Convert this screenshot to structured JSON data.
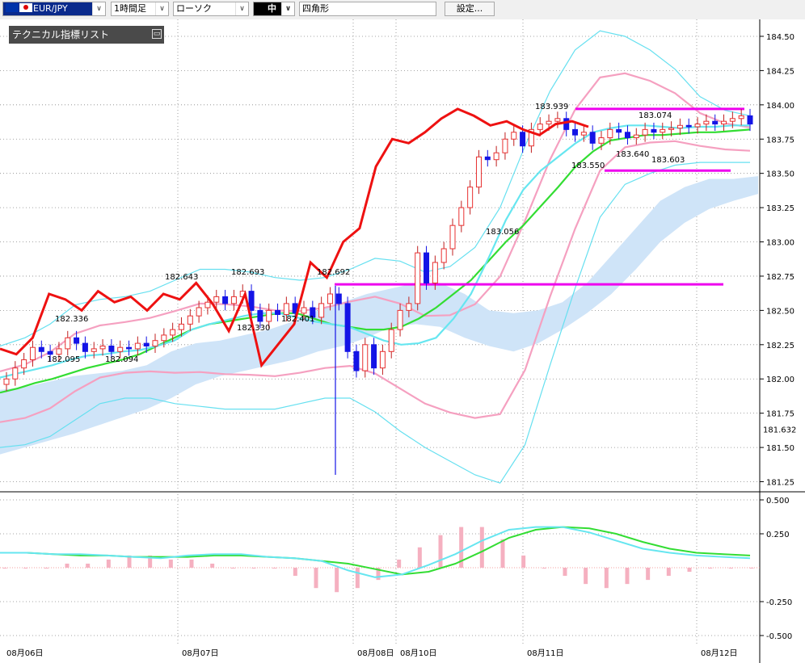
{
  "toolbar": {
    "pair": "EUR/JPY",
    "period": "1時間足",
    "chart_style": "ローソク",
    "line_width": "中",
    "drawing_tool": "四角形",
    "settings_label": "設定..."
  },
  "indicator_panel": {
    "title": "テクニカル指標リスト"
  },
  "colors": {
    "bull_candle": "#e83030",
    "bear_candle": "#1414e6",
    "bollinger_outer": "#66e0f0",
    "bollinger_inner": "#f5a0c0",
    "kumo_fill": "#cfe4f8",
    "tenkan_line": "#33dd33",
    "kijun_line": "#66e6f0",
    "chikou_line": "#ee1111",
    "horizontal_line": "#ee00ee",
    "macd_line": "#66e6f0",
    "signal_line": "#33dd33",
    "macd_histogram": "#f5b0c0"
  },
  "chart_data": [
    {
      "type": "candlestick",
      "title": "EUR/JPY 1時間足",
      "y_ticks": [
        "184.50",
        "184.25",
        "184.00",
        "183.75",
        "183.50",
        "183.25",
        "183.00",
        "182.75",
        "182.50",
        "182.25",
        "182.00",
        "181.75",
        "181.50",
        "181.25"
      ],
      "ylim": [
        181.2,
        184.6
      ],
      "current_price": "181.632",
      "x_labels": [
        "08月06日",
        "08月07日",
        "08月08日",
        "08月10日",
        "08月11日",
        "08月12日"
      ],
      "annotations": [
        "182.336",
        "182.095",
        "182.094",
        "182.643",
        "182.693",
        "182.330",
        "182.401",
        "182.692",
        "183.056",
        "183.939",
        "183.074",
        "183.550",
        "183.640",
        "183.603"
      ],
      "horizontal_lines": [
        182.69,
        183.97,
        183.52
      ],
      "series": [
        {
          "role": "candles",
          "values": [
            182.0,
            182.08,
            182.14,
            182.23,
            182.2,
            182.18,
            182.22,
            182.3,
            182.26,
            182.2,
            182.22,
            182.24,
            182.2,
            182.23,
            182.22,
            182.26,
            182.24,
            182.28,
            182.32,
            182.36,
            182.4,
            182.46,
            182.52,
            182.56,
            182.6,
            182.55,
            182.6,
            182.64,
            182.5,
            182.42,
            182.5,
            182.47,
            182.55,
            182.48,
            182.52,
            182.45,
            182.55,
            182.62,
            182.55,
            182.2,
            182.06,
            182.25,
            182.08,
            182.2,
            182.36,
            182.5,
            182.55,
            182.92,
            182.7,
            182.85,
            182.95,
            183.12,
            183.25,
            183.4,
            183.62,
            183.6,
            183.65,
            183.75,
            183.8,
            183.7,
            183.82,
            183.86,
            183.88,
            183.9,
            183.82,
            183.78,
            183.8,
            183.72,
            183.76,
            183.82,
            183.8,
            183.76,
            183.78,
            183.82,
            183.8,
            183.82,
            183.83,
            183.85,
            183.84,
            183.86,
            183.88,
            183.86,
            183.88,
            183.9,
            183.92,
            183.86
          ]
        },
        {
          "role": "chikou",
          "values": [
            182.22,
            182.18,
            182.3,
            182.62,
            182.58,
            182.5,
            182.64,
            182.56,
            182.6,
            182.5,
            182.62,
            182.58,
            182.7,
            182.55,
            182.35,
            182.62,
            182.1,
            182.25,
            182.4,
            182.85,
            182.74,
            183.0,
            183.1,
            183.55,
            183.75,
            183.72,
            183.8,
            183.9,
            183.97,
            183.92,
            183.85,
            183.88,
            183.82,
            183.78,
            183.86,
            183.88,
            183.84
          ]
        },
        {
          "role": "tenkan",
          "values": [
            182.01,
            182.04,
            182.07,
            182.1,
            182.14,
            182.17,
            182.18,
            182.2,
            182.21,
            182.24,
            182.28,
            182.36,
            182.4,
            182.43,
            182.46,
            182.48,
            182.48,
            182.45,
            182.42,
            182.4,
            182.38,
            182.33,
            182.28,
            182.25,
            182.26,
            182.3,
            182.44,
            182.62,
            182.88,
            183.16,
            183.38,
            183.52,
            183.62,
            183.72,
            183.8,
            183.83,
            183.85,
            183.85,
            183.84,
            183.83,
            183.84,
            183.84,
            183.85,
            183.85
          ]
        },
        {
          "role": "kijun",
          "values": [
            181.9,
            181.93,
            181.97,
            182.0,
            182.04,
            182.08,
            182.11,
            182.14,
            182.18,
            182.24,
            182.3,
            182.36,
            182.4,
            182.42,
            182.44,
            182.46,
            182.48,
            182.48,
            182.44,
            182.4,
            182.38,
            182.36,
            182.36,
            182.38,
            182.44,
            182.52,
            182.62,
            182.72,
            182.86,
            183.0,
            183.12,
            183.26,
            183.4,
            183.55,
            183.66,
            183.74,
            183.76,
            183.78,
            183.78,
            183.79,
            183.8,
            183.8,
            183.81,
            183.82
          ]
        },
        {
          "role": "bollinger_upper2",
          "values": [
            182.24,
            182.3,
            182.4,
            182.54,
            182.58,
            182.6,
            182.64,
            182.72,
            182.8,
            182.8,
            182.78,
            182.74,
            182.72,
            182.74,
            182.8,
            182.88,
            182.86,
            182.78,
            182.82,
            182.96,
            183.25,
            183.7,
            184.1,
            184.4,
            184.54,
            184.5,
            184.4,
            184.26,
            184.06,
            183.96,
            183.92
          ]
        },
        {
          "role": "bollinger_lower2",
          "values": [
            181.5,
            181.52,
            181.58,
            181.7,
            181.82,
            181.86,
            181.86,
            181.82,
            181.8,
            181.78,
            181.78,
            181.78,
            181.82,
            181.86,
            181.86,
            181.76,
            181.62,
            181.5,
            181.4,
            181.3,
            181.24,
            181.52,
            182.1,
            182.66,
            183.18,
            183.42,
            183.5,
            183.56,
            183.58,
            183.58,
            183.58
          ]
        }
      ]
    },
    {
      "type": "line",
      "title": "MACD",
      "y_ticks": [
        "0.500",
        "0.250",
        "-0.250",
        "-0.500"
      ],
      "ylim": [
        -0.5,
        0.5
      ],
      "series": [
        {
          "role": "macd",
          "values": [
            0.11,
            0.11,
            0.1,
            0.1,
            0.09,
            0.08,
            0.07,
            0.09,
            0.1,
            0.1,
            0.08,
            0.07,
            0.05,
            -0.02,
            -0.07,
            -0.05,
            0.02,
            0.1,
            0.2,
            0.28,
            0.3,
            0.3,
            0.26,
            0.2,
            0.14,
            0.11,
            0.09,
            0.08,
            0.07
          ]
        },
        {
          "role": "signal",
          "values": [
            0.11,
            0.11,
            0.1,
            0.09,
            0.09,
            0.08,
            0.08,
            0.08,
            0.09,
            0.09,
            0.08,
            0.07,
            0.05,
            0.03,
            -0.01,
            -0.05,
            -0.03,
            0.03,
            0.12,
            0.22,
            0.28,
            0.3,
            0.29,
            0.25,
            0.19,
            0.14,
            0.11,
            0.1,
            0.09
          ]
        },
        {
          "role": "histogram",
          "values": [
            0.0,
            0.0,
            0.0,
            0.01,
            0.01,
            0.02,
            0.03,
            0.03,
            0.02,
            0.02,
            0.01,
            0.0,
            0.0,
            0.0,
            -0.02,
            -0.05,
            -0.06,
            -0.05,
            -0.03,
            0.02,
            0.05,
            0.08,
            0.1,
            0.1,
            0.07,
            0.03,
            0.0,
            -0.02,
            -0.04,
            -0.05,
            -0.04,
            -0.03,
            -0.02,
            -0.01,
            0.0,
            0.0,
            0.0
          ]
        }
      ]
    }
  ]
}
